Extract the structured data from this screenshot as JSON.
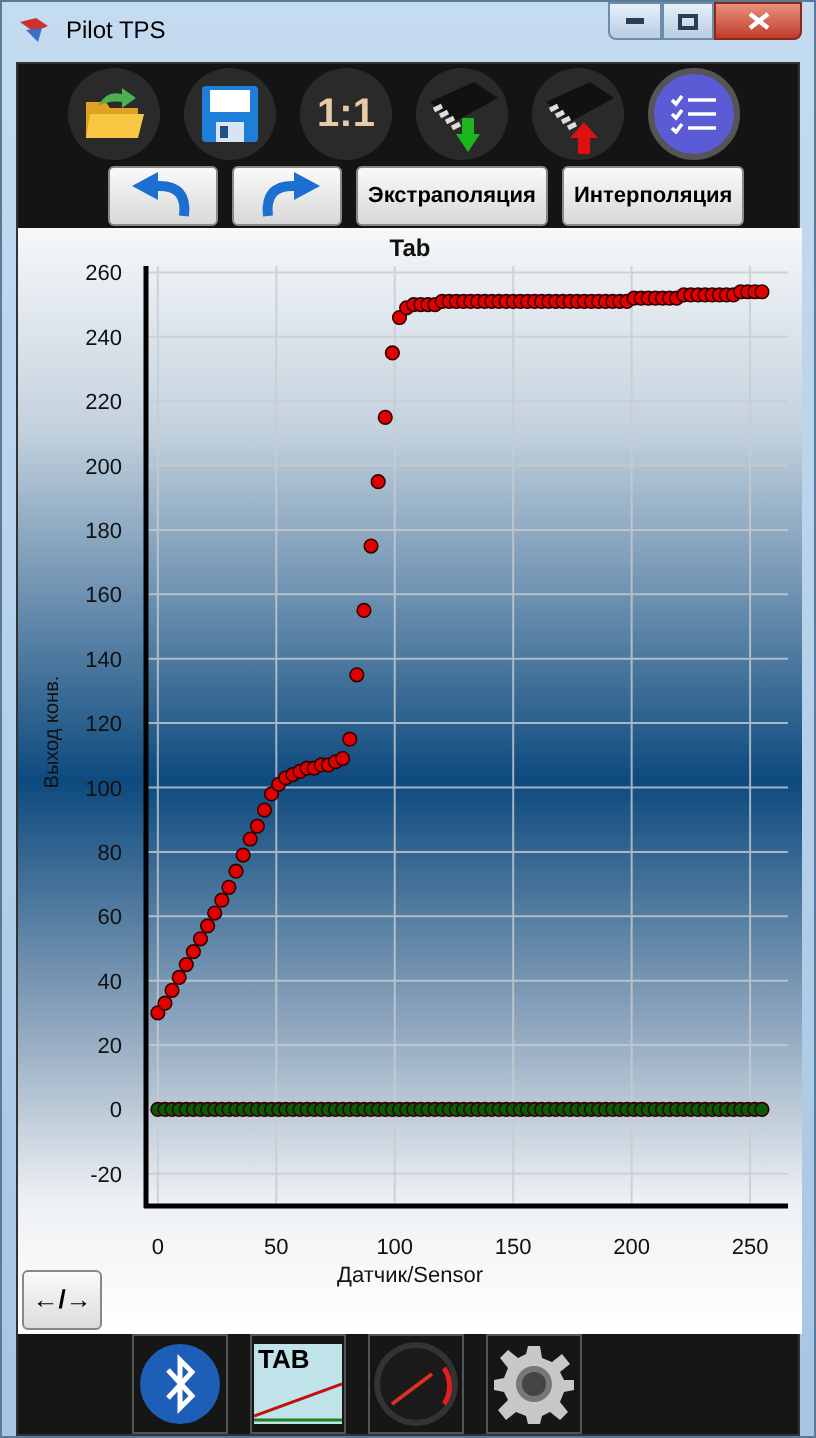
{
  "window": {
    "title": "Pilot TPS"
  },
  "toolbar": {
    "ratio_label": "1:1"
  },
  "buttons": [
    {
      "kind": "undo"
    },
    {
      "kind": "redo"
    },
    {
      "kind": "text",
      "label": "Экстраполяция"
    },
    {
      "kind": "text",
      "label": "Интерполяция"
    }
  ],
  "chart": {
    "chart_data": {
      "type": "scatter",
      "title": "Tab",
      "xlabel": "Датчик/Sensor",
      "ylabel": "Выход конв.",
      "x": [
        0,
        3,
        6,
        9,
        12,
        15,
        18,
        21,
        24,
        27,
        30,
        33,
        36,
        39,
        42,
        45,
        48,
        51,
        54,
        57,
        60,
        63,
        66,
        69,
        72,
        75,
        78,
        81,
        84,
        87,
        90,
        93,
        96,
        99,
        102,
        105,
        108,
        111,
        114,
        117,
        120,
        123,
        126,
        129,
        132,
        135,
        138,
        141,
        144,
        147,
        150,
        153,
        156,
        159,
        162,
        165,
        168,
        171,
        174,
        177,
        180,
        183,
        186,
        189,
        192,
        195,
        198,
        201,
        204,
        207,
        210,
        213,
        216,
        219,
        222,
        225,
        228,
        231,
        234,
        237,
        240,
        243,
        246,
        249,
        252,
        255
      ],
      "series": [
        {
          "color": "#e00000",
          "values": [
            30,
            33,
            37,
            41,
            45,
            49,
            53,
            57,
            61,
            65,
            69,
            74,
            79,
            84,
            88,
            93,
            98,
            101,
            103,
            104,
            105,
            106,
            106,
            107,
            107,
            108,
            109,
            115,
            135,
            155,
            175,
            195,
            215,
            235,
            246,
            249,
            250,
            250,
            250,
            250,
            251,
            251,
            251,
            251,
            251,
            251,
            251,
            251,
            251,
            251,
            251,
            251,
            251,
            251,
            251,
            251,
            251,
            251,
            251,
            251,
            251,
            251,
            251,
            251,
            251,
            251,
            251,
            252,
            252,
            252,
            252,
            252,
            252,
            252,
            253,
            253,
            253,
            253,
            253,
            253,
            253,
            253,
            254,
            254,
            254,
            254
          ]
        },
        {
          "color": "#0a5a0a",
          "values": [
            0,
            0,
            0,
            0,
            0,
            0,
            0,
            0,
            0,
            0,
            0,
            0,
            0,
            0,
            0,
            0,
            0,
            0,
            0,
            0,
            0,
            0,
            0,
            0,
            0,
            0,
            0,
            0,
            0,
            0,
            0,
            0,
            0,
            0,
            0,
            0,
            0,
            0,
            0,
            0,
            0,
            0,
            0,
            0,
            0,
            0,
            0,
            0,
            0,
            0,
            0,
            0,
            0,
            0,
            0,
            0,
            0,
            0,
            0,
            0,
            0,
            0,
            0,
            0,
            0,
            0,
            0,
            0,
            0,
            0,
            0,
            0,
            0,
            0,
            0,
            0,
            0,
            0,
            0,
            0,
            0,
            0,
            0,
            0,
            0,
            0
          ]
        }
      ],
      "xlim": [
        -5,
        266
      ],
      "ylim": [
        -30,
        262
      ],
      "grid": true,
      "xticks": [
        0,
        50,
        100,
        150,
        200,
        250
      ],
      "yticks": [
        -20,
        0,
        20,
        40,
        60,
        80,
        100,
        120,
        140,
        160,
        180,
        200,
        220,
        240,
        260
      ]
    }
  },
  "swap_button": {
    "label": "←/→"
  },
  "bottom_bar": {
    "tab_icon_label": "TAB"
  }
}
